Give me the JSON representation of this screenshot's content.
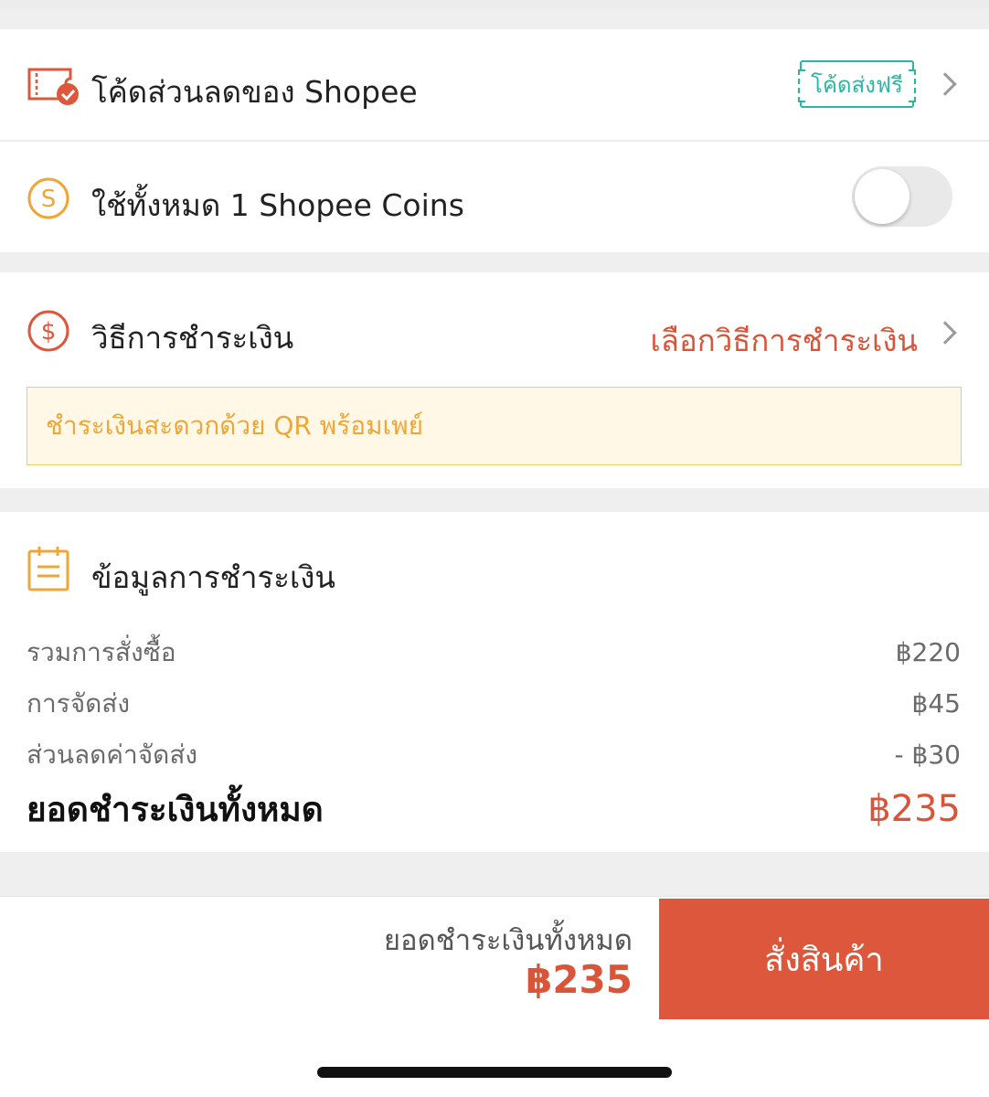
{
  "voucher": {
    "title": "โค้ดส่วนลดของ Shopee",
    "tag": "โค้ดส่งฟรี",
    "icon": "voucher-ticket-icon"
  },
  "coins": {
    "title": "ใช้ทั้งหมด 1 Shopee Coins",
    "icon": "coin-icon",
    "toggle_on": false
  },
  "payment": {
    "title": "วิธีการชำระเงิน",
    "select_label": "เลือกวิธีการชำระเงิน",
    "promo": "ชำระเงินสะดวกด้วย QR พร้อมเพย์",
    "icon": "dollar-icon"
  },
  "info": {
    "title": "ข้อมูลการชำระเงิน",
    "icon": "document-icon",
    "lines": [
      {
        "label": "รวมการสั่งซื้อ",
        "value": "฿220"
      },
      {
        "label": "การจัดส่ง",
        "value": "฿45"
      },
      {
        "label": "ส่วนลดค่าจัดส่ง",
        "value": "- ฿30"
      }
    ],
    "total_label": "ยอดชำระเงินทั้งหมด",
    "total_value": "฿235"
  },
  "bottom": {
    "total_label": "ยอดชำระเงินทั้งหมด",
    "total_value": "฿235",
    "order_button": "สั่งสินค้า"
  },
  "colors": {
    "accent": "#dc573b",
    "teal": "#2bb5a3",
    "gold": "#f0a637"
  }
}
